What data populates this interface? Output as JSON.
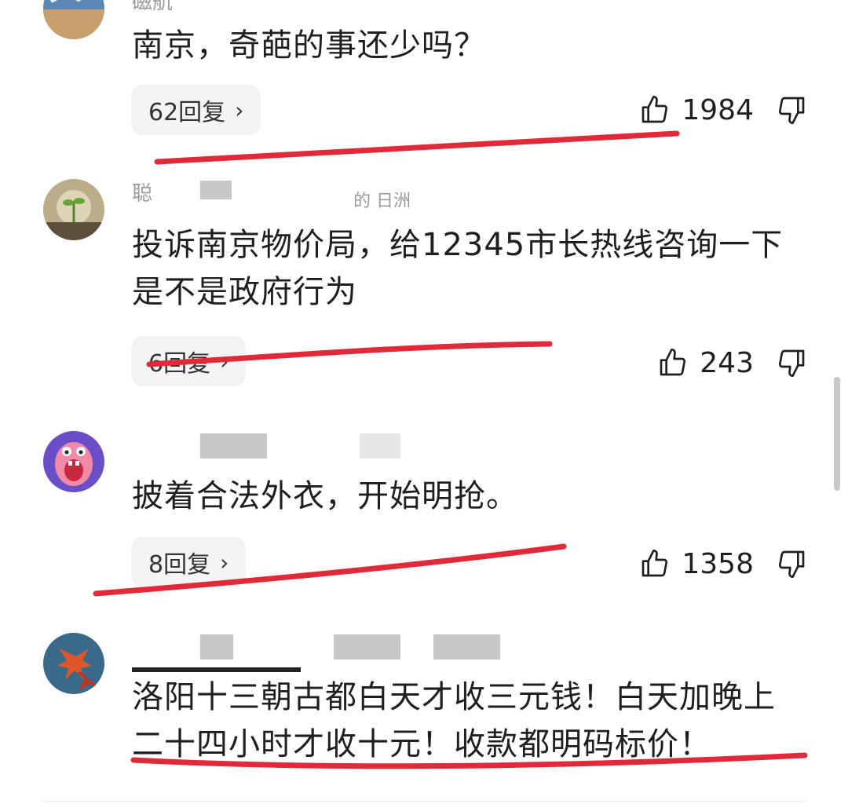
{
  "comments": [
    {
      "username": "磁航",
      "text": "南京，奇葩的事还少吗？",
      "replies": "62回复",
      "likes": "1984"
    },
    {
      "username": "聪",
      "username_tail": "的 日洲",
      "text": "投诉南京物价局，给12345市长热线咨询一下是不是政府行为",
      "replies": "6回复",
      "likes": "243"
    },
    {
      "username": "",
      "text": "披着合法外衣，开始明抢。",
      "replies": "8回复",
      "likes": "1358"
    },
    {
      "username": "",
      "text": "洛阳十三朝古都白天才收三元钱！白天加晚上二十四小时才收十元！收款都明码标价！"
    }
  ],
  "icons": {
    "like": "thumbs-up-icon",
    "dislike": "thumbs-down-icon",
    "chevron": "chevron-right-icon"
  },
  "colors": {
    "annotation": "#e02a3a",
    "pill_bg": "#f4f4f4",
    "username": "#9a9a9a"
  }
}
